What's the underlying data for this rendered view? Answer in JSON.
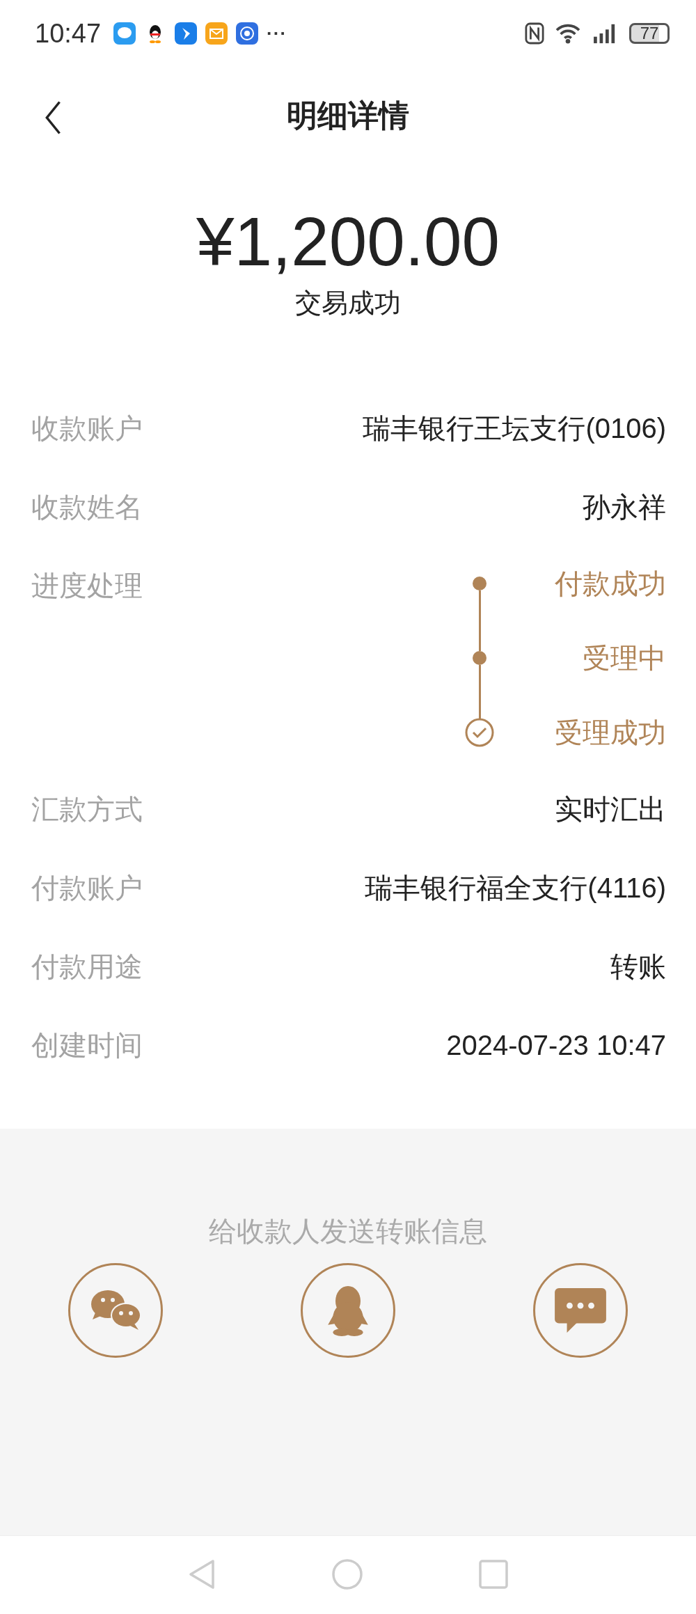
{
  "status_bar": {
    "time": "10:47",
    "more": "···",
    "battery": "77"
  },
  "header": {
    "title": "明细详情"
  },
  "summary": {
    "amount": "¥1,200.00",
    "status": "交易成功"
  },
  "details": [
    {
      "kind": "text",
      "label": "收款账户",
      "value": "瑞丰银行王坛支行(0106)"
    },
    {
      "kind": "text",
      "label": "收款姓名",
      "value": "孙永祥"
    },
    {
      "kind": "progress",
      "label": "进度处理",
      "steps": [
        {
          "text": "付款成功",
          "checked": false
        },
        {
          "text": "受理中",
          "checked": false
        },
        {
          "text": "受理成功",
          "checked": true
        }
      ]
    },
    {
      "kind": "text",
      "label": "汇款方式",
      "value": "实时汇出"
    },
    {
      "kind": "text",
      "label": "付款账户",
      "value": "瑞丰银行福全支行(4116)"
    },
    {
      "kind": "text",
      "label": "付款用途",
      "value": "转账"
    },
    {
      "kind": "text",
      "label": "创建时间",
      "value": "2024-07-23 10:47"
    }
  ],
  "share": {
    "title": "给收款人发送转账信息",
    "buttons": [
      {
        "kind": "wechat"
      },
      {
        "kind": "qq"
      },
      {
        "kind": "sms"
      }
    ]
  }
}
